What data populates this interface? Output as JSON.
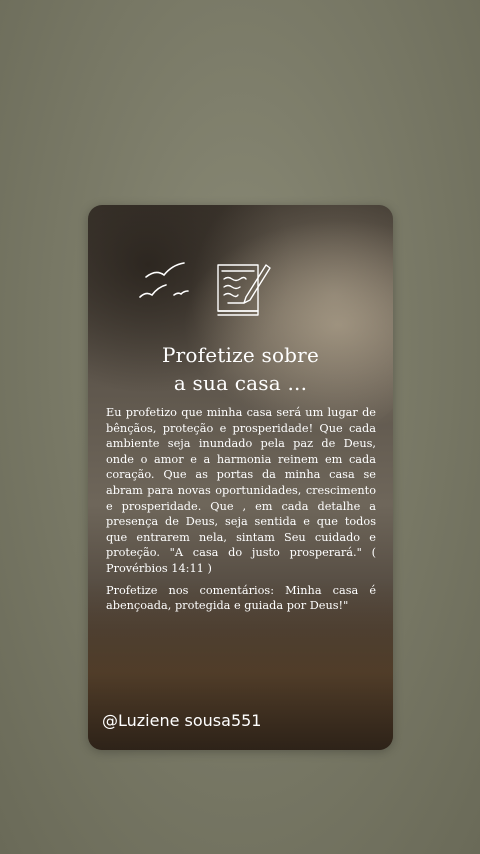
{
  "post": {
    "title_line1": "Profetize sobre",
    "title_line2": "a sua casa ...",
    "paragraph1": "Eu profetizo que minha casa será um lugar de bênçãos, proteção e prosperidade! Que cada ambiente seja inundado pela paz de Deus, onde o amor e a harmonia reinem em cada coração. Que as portas da minha casa se abram para novas oportunidades, crescimento e prosperidade. Que , em cada detalhe a presença de Deus, seja sentida e que todos que entrarem nela, sintam Seu cuidado e proteção. \"A casa do justo prosperará.\" ( Provérbios 14:11 )",
    "paragraph2": "Profetize nos comentários: Minha casa é abençoada, protegida e guiada por Deus!\"",
    "watermark": "@Luziene sousa551"
  },
  "icons": {
    "birds": "birds-icon",
    "writing": "writing-paper-icon"
  },
  "colors": {
    "background": "#7b7b68",
    "card_dark": "#3d362e",
    "text": "#ffffff"
  }
}
